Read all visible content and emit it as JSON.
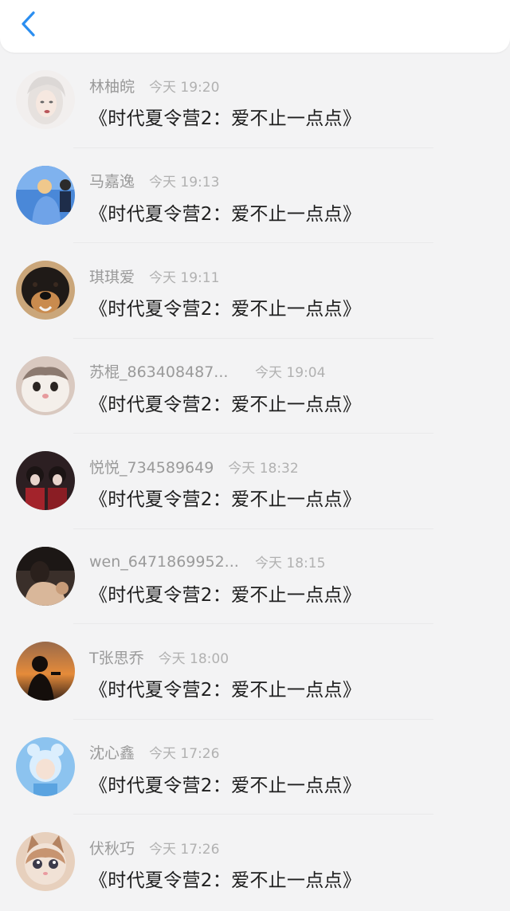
{
  "header": {
    "back_icon": "chevron-left-icon",
    "accent_color": "#2b8ef0"
  },
  "comments": [
    {
      "name": "林柚皖",
      "time": "今天 19:20",
      "message": "《时代夏令营2：爱不止一点点》"
    },
    {
      "name": "马嘉逸",
      "time": "今天 19:13",
      "message": "《时代夏令营2：爱不止一点点》"
    },
    {
      "name": "琪琪爱",
      "time": "今天 19:11",
      "message": "《时代夏令营2：爱不止一点点》"
    },
    {
      "name": "苏棍_863408487...",
      "time": "今天 19:04",
      "message": "《时代夏令营2：爱不止一点点》"
    },
    {
      "name": "悦悦_734589649",
      "time": "今天 18:32",
      "message": "《时代夏令营2：爱不止一点点》"
    },
    {
      "name": "wen_6471869952...",
      "time": "今天 18:15",
      "message": "《时代夏令营2：爱不止一点点》"
    },
    {
      "name": "T张思乔",
      "time": "今天 18:00",
      "message": "《时代夏令营2：爱不止一点点》"
    },
    {
      "name": "沈心鑫",
      "time": "今天 17:26",
      "message": "《时代夏令营2：爱不止一点点》"
    },
    {
      "name": "伏秋巧",
      "time": "今天 17:26",
      "message": "《时代夏令营2：爱不止一点点》"
    }
  ]
}
